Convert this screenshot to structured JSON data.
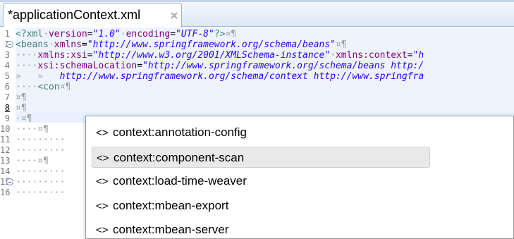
{
  "tab": {
    "title": "*applicationContext.xml",
    "close_icon": "close-icon"
  },
  "editor": {
    "line_numbers": [
      "1",
      "2",
      "3",
      "4",
      "5",
      "6",
      "7",
      "8",
      "9",
      "10",
      "11",
      "12",
      "13",
      "14",
      "15",
      "16"
    ],
    "lines": [
      {
        "prefix": "",
        "parts": [
          {
            "c": "tag",
            "t": "<?xml"
          },
          {
            "c": "ws",
            "t": "·"
          },
          {
            "c": "attr",
            "t": "version"
          },
          {
            "c": "txt",
            "t": "="
          },
          {
            "c": "val",
            "t": "\"1.0\""
          },
          {
            "c": "ws",
            "t": "·"
          },
          {
            "c": "attr",
            "t": "encoding"
          },
          {
            "c": "txt",
            "t": "="
          },
          {
            "c": "val",
            "t": "\"UTF-8\""
          },
          {
            "c": "tag",
            "t": "?>"
          },
          {
            "c": "ws",
            "t": "¤¶"
          }
        ]
      },
      {
        "prefix": "",
        "parts": [
          {
            "c": "tag",
            "t": "<beans"
          },
          {
            "c": "ws",
            "t": "·"
          },
          {
            "c": "attr",
            "t": "xmlns"
          },
          {
            "c": "txt",
            "t": "="
          },
          {
            "c": "val",
            "t": "\"http://www.springframework.org/schema/beans\""
          },
          {
            "c": "ws",
            "t": "¤¶"
          }
        ]
      },
      {
        "prefix": "····",
        "parts": [
          {
            "c": "attr",
            "t": "xmlns:xsi"
          },
          {
            "c": "txt",
            "t": "="
          },
          {
            "c": "val",
            "t": "\"http://www.w3.org/2001/XMLSchema-instance\""
          },
          {
            "c": "ws",
            "t": "·"
          },
          {
            "c": "attr",
            "t": "xmlns:context"
          },
          {
            "c": "txt",
            "t": "="
          },
          {
            "c": "val",
            "t": "\"h"
          }
        ]
      },
      {
        "prefix": "····",
        "parts": [
          {
            "c": "attr",
            "t": "xsi:schemaLocation"
          },
          {
            "c": "txt",
            "t": "="
          },
          {
            "c": "val",
            "t": "\"http://www.springframework.org/schema/beans http:/"
          }
        ]
      },
      {
        "prefix": "»   »   ",
        "parts": [
          {
            "c": "val",
            "t": "http://www.springframework.org/schema/context http://www.springfra"
          }
        ]
      },
      {
        "prefix": "····",
        "parts": [
          {
            "c": "tag",
            "t": "<con"
          },
          {
            "c": "ws",
            "t": "¤¶"
          }
        ]
      },
      {
        "prefix": "",
        "parts": [
          {
            "c": "ws",
            "t": "¤¶"
          }
        ]
      },
      {
        "prefix": "",
        "parts": [
          {
            "c": "ws",
            "t": "¤¶"
          }
        ]
      },
      {
        "prefix": "",
        "parts": [
          {
            "c": "ws",
            "t": "·¤¶"
          }
        ]
      },
      {
        "prefix": "",
        "parts": [
          {
            "c": "ws",
            "t": "····¤¶"
          }
        ]
      },
      {
        "prefix": "",
        "parts": [
          {
            "c": "ws",
            "t": "·········"
          }
        ]
      },
      {
        "prefix": "",
        "parts": [
          {
            "c": "ws",
            "t": "·········"
          }
        ]
      },
      {
        "prefix": "",
        "parts": [
          {
            "c": "ws",
            "t": "····¤¶"
          }
        ]
      },
      {
        "prefix": "",
        "parts": [
          {
            "c": "ws",
            "t": "·········"
          }
        ]
      },
      {
        "prefix": "",
        "parts": [
          {
            "c": "ws",
            "t": "·········"
          }
        ]
      },
      {
        "prefix": "",
        "parts": [
          {
            "c": "ws",
            "t": "·········"
          }
        ]
      }
    ]
  },
  "content_assist": {
    "items": [
      {
        "icon": "<>",
        "label": "context:annotation-config"
      },
      {
        "icon": "<>",
        "label": "context:component-scan"
      },
      {
        "icon": "<>",
        "label": "context:load-time-weaver"
      },
      {
        "icon": "<>",
        "label": "context:mbean-export"
      },
      {
        "icon": "<>",
        "label": "context:mbean-server"
      }
    ],
    "selected_index": 1
  },
  "colors": {
    "tag": "#3f7f7f",
    "attribute": "#7f007f",
    "value": "#2a00ff",
    "whitespace_marker": "#a0a0a0",
    "tab_background": "#dde8f4"
  }
}
